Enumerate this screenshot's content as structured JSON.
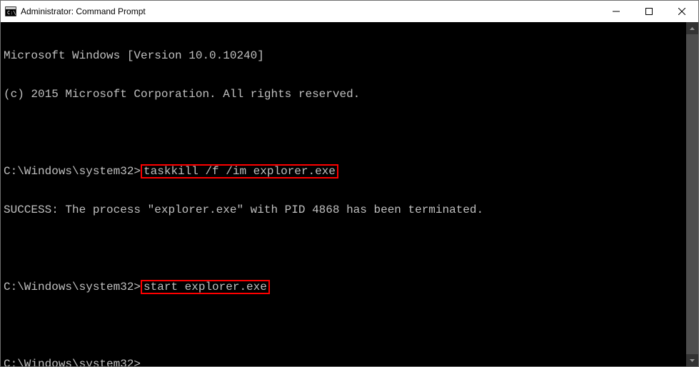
{
  "titlebar": {
    "title": "Administrator: Command Prompt"
  },
  "terminal": {
    "line1": "Microsoft Windows [Version 10.0.10240]",
    "line2": "(c) 2015 Microsoft Corporation. All rights reserved.",
    "blank1": "",
    "prompt1_prefix": "C:\\Windows\\system32>",
    "command1": "taskkill /f /im explorer.exe",
    "output1": "SUCCESS: The process \"explorer.exe\" with PID 4868 has been terminated.",
    "blank2": "",
    "prompt2_prefix": "C:\\Windows\\system32>",
    "command2": "start explorer.exe",
    "blank3": "",
    "prompt3": "C:\\Windows\\system32>"
  }
}
